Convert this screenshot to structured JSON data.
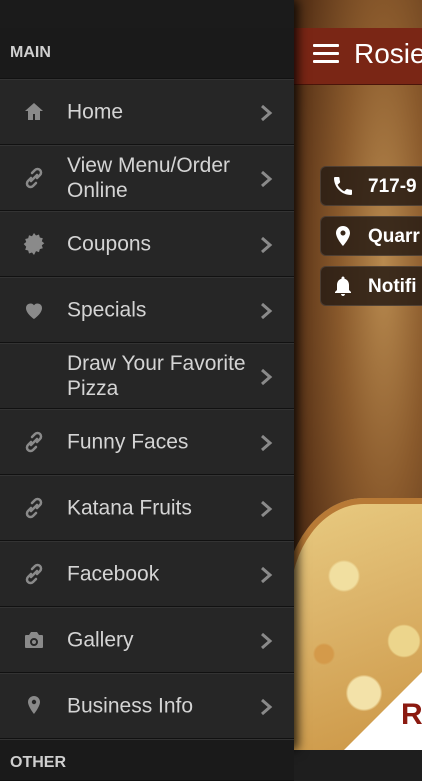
{
  "colors": {
    "drawer_bg": "#262626",
    "text": "#d4d4d4",
    "topbar": "#7a2615"
  },
  "app": {
    "title": "Rosie",
    "buttons": [
      {
        "label": "717-9",
        "icon": "phone-icon"
      },
      {
        "label": "Quarr",
        "icon": "location-pin-icon"
      },
      {
        "label": "Notifi",
        "icon": "bell-icon"
      }
    ],
    "corner_text": "R"
  },
  "drawer": {
    "section_main": "MAIN",
    "section_other": "OTHER",
    "items": [
      {
        "label": "Home",
        "icon": "home-icon"
      },
      {
        "label": "View Menu/Order Online",
        "icon": "link-icon"
      },
      {
        "label": "Coupons",
        "icon": "badge-icon"
      },
      {
        "label": "Specials",
        "icon": "heart-icon"
      },
      {
        "label": "Draw Your Favorite Pizza",
        "icon": "none"
      },
      {
        "label": "Funny Faces",
        "icon": "link-icon"
      },
      {
        "label": "Katana Fruits",
        "icon": "link-icon"
      },
      {
        "label": "Facebook",
        "icon": "link-icon"
      },
      {
        "label": "Gallery",
        "icon": "camera-icon"
      },
      {
        "label": "Business Info",
        "icon": "location-pin-icon"
      }
    ]
  }
}
